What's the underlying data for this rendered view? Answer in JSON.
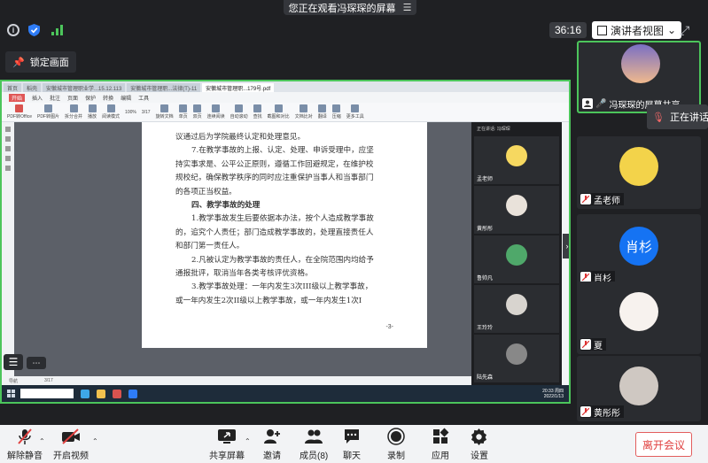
{
  "banner": {
    "text": "您正在观看冯琛琛的屏幕"
  },
  "topbar": {
    "timer": "36:16",
    "view_label": "演讲者视图"
  },
  "lock": {
    "label": "锁定画面"
  },
  "shared_screen": {
    "tabs": [
      "首页",
      "稻壳",
      "安徽城市管理职业学...15.12.113",
      "安徽城市管理职...法律(T)-11",
      "安徽城市管理职...179号.pdf"
    ],
    "menu": [
      "开始",
      "插入",
      "批注",
      "页面",
      "保护",
      "转换",
      "编辑",
      "工具"
    ],
    "ribbon": [
      "PDF转Office",
      "PDF转图片",
      "拆分合并",
      "播放",
      "阅读模式",
      "100%",
      "3/17",
      "旋转文档",
      "单页",
      "双页",
      "连续阅读",
      "自动滚动",
      "查找",
      "截图和对比",
      "文档比对",
      "翻译",
      "压缩",
      "更多工具"
    ],
    "page_paragraphs": [
      {
        "text": "议通过后为学院最终认定和处理意见。",
        "style": "plain"
      },
      {
        "text": "7.在教学事故的上报、认定、处理、申诉受理中，应坚",
        "style": "indent"
      },
      {
        "text": "持实事求是、公平公正原则，遵循工作回避规定，在维护校",
        "style": "plain"
      },
      {
        "text": "规校纪，确保教学秩序的同时应注重保护当事人和当事部门",
        "style": "plain"
      },
      {
        "text": "的各项正当权益。",
        "style": "plain"
      },
      {
        "text": "四、教学事故的处理",
        "style": "heading"
      },
      {
        "text": "1.教学事故发生后要依据本办法，按个人造成教学事故",
        "style": "indent"
      },
      {
        "text": "的，追究个人责任；部门造成教学事故的，处理直接责任人",
        "style": "plain"
      },
      {
        "text": "和部门第一责任人。",
        "style": "plain"
      },
      {
        "text": "2.凡被认定为教学事故的责任人，在全院范围内均给予",
        "style": "indent"
      },
      {
        "text": "通报批评，取消当年各类考核评优资格。",
        "style": "plain"
      },
      {
        "text": "3.教学事故处理：一年内发生3次III级以上教学事故，",
        "style": "indent"
      },
      {
        "text": "或一年内发生2次II级以上教学事故，或一年内发生1次I",
        "style": "plain"
      }
    ],
    "page_number": "-3-",
    "status_items": [
      "导航",
      "3/17"
    ],
    "inner_strip_title": "正在讲话: 冯琛琛",
    "inner_participants": [
      "孟老师",
      "黄彤彤",
      "鲁帅凡",
      "王玲玲",
      "陆先森"
    ],
    "clock_time": "20:33 周四",
    "clock_date": "2022/1/13"
  },
  "participants": [
    {
      "name": "冯琛琛的屏幕共享",
      "type": "image"
    },
    {
      "name": "孟老师",
      "type": "image"
    },
    {
      "name": "肖杉",
      "type": "text",
      "avatar_text": "肖杉"
    },
    {
      "name": "夏",
      "type": "image"
    },
    {
      "name": "黄彤彤",
      "type": "image"
    },
    {
      "name": "",
      "type": "image"
    }
  ],
  "speaking": {
    "label": "正在讲话"
  },
  "toolbar": {
    "unmute": "解除静音",
    "video": "开启视频",
    "share": "共享屏幕",
    "invite": "邀请",
    "members": "成员(8)",
    "chat": "聊天",
    "record": "录制",
    "apps": "应用",
    "settings": "设置",
    "leave": "离开会议"
  },
  "colors": {
    "accent_green": "#4cc55b",
    "leave_red": "#e0403f",
    "avatar_blue": "#1573f3"
  }
}
